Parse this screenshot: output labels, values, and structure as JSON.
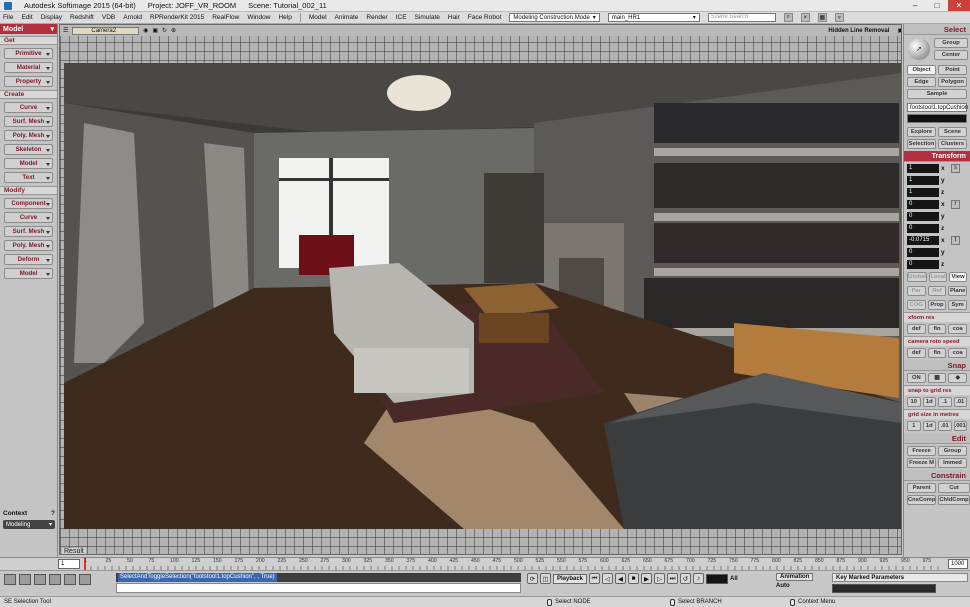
{
  "window": {
    "app_title": "Autodesk Softimage 2015 (64-bit)",
    "project": "Project: JOFF_VR_ROOM",
    "scene": "Scene: Tutorial_002_11"
  },
  "menubar": {
    "items": [
      "File",
      "Edit",
      "Display",
      "Redshift",
      "VDB",
      "Arnold",
      "RPRenderKit 2015",
      "RealFlow",
      "Window",
      "Help",
      "Model",
      "Animate",
      "Render",
      "ICE",
      "Simulate",
      "Hair",
      "Face Robot"
    ],
    "construction_mode": "Modeling Construction Mode",
    "render_pass": "main_HR1",
    "search_placeholder": "Scene Search"
  },
  "left_panel": {
    "title": "Model",
    "sections": [
      {
        "label": "Get",
        "buttons": [
          "Primitive",
          "Material",
          "Property"
        ]
      },
      {
        "label": "Create",
        "buttons": [
          "Curve",
          "Surf. Mesh",
          "Poly. Mesh",
          "Skeleton",
          "Model",
          "Text"
        ]
      },
      {
        "label": "Modify",
        "buttons": [
          "Component",
          "Curve",
          "Surf. Mesh",
          "Poly. Mesh",
          "Deform",
          "Model"
        ]
      }
    ],
    "context_label": "Context",
    "context_value": "Modeling"
  },
  "viewport": {
    "camera": "Camera2",
    "display_mode": "Hidden Line Removal",
    "result_label": "Result"
  },
  "right_panel": {
    "select_title": "Select",
    "select_buttons": [
      "Group",
      "Center",
      "Object",
      "Point",
      "Edge",
      "Polygon",
      "Sample"
    ],
    "selected_name": "footstool1.topCushion",
    "explore_buttons": [
      "Explore",
      "Scene",
      "Selection",
      "Clusters"
    ],
    "transform_title": "Transform",
    "transform_values": [
      {
        "value": "1",
        "axis": "x",
        "icon": "s"
      },
      {
        "value": "1",
        "axis": "y",
        "icon": ""
      },
      {
        "value": "1",
        "axis": "z",
        "icon": ""
      },
      {
        "value": "0",
        "axis": "x",
        "icon": "r"
      },
      {
        "value": "0",
        "axis": "y",
        "icon": ""
      },
      {
        "value": "0",
        "axis": "z",
        "icon": ""
      },
      {
        "value": "-0.0715",
        "axis": "x",
        "icon": "t"
      },
      {
        "value": "0",
        "axis": "y",
        "icon": ""
      },
      {
        "value": "0",
        "axis": "z",
        "icon": ""
      }
    ],
    "ref_row1": [
      "Global",
      "Local",
      "View"
    ],
    "ref_row2": [
      "Par",
      "Ref",
      "Plane"
    ],
    "ref_row3": [
      "COG",
      "Prop",
      "Sym"
    ],
    "xform_label": "xform res",
    "xform_buttons": [
      "def",
      "fin",
      "coa"
    ],
    "camera_label": "camera roto speed",
    "camera_buttons": [
      "def",
      "fin",
      "coa"
    ],
    "snap_title": "Snap",
    "snap_state": "ON",
    "snap_grid_label": "snap to grid res",
    "snap_grid_buttons": [
      "10",
      "1d",
      ".1",
      ".01"
    ],
    "grid_size_label": "grid size in metres",
    "grid_size_buttons": [
      "1",
      "1d",
      ".01",
      ".001"
    ],
    "edit_title": "Edit",
    "edit_buttons": [
      "Freeze",
      "Group",
      "Freeze M",
      "Immed"
    ],
    "constrain_title": "Constrain",
    "constrain_buttons": [
      "Parent",
      "Cut",
      "CnsComp",
      "ChldComp"
    ]
  },
  "timeline": {
    "start": "1",
    "end": "1000",
    "labels": [
      "1",
      "25",
      "50",
      "75",
      "100",
      "125",
      "150",
      "175",
      "200",
      "225",
      "250",
      "275",
      "300",
      "325",
      "350",
      "375",
      "400",
      "425",
      "450",
      "475",
      "500",
      "525",
      "550",
      "575",
      "600",
      "625",
      "650",
      "675",
      "700",
      "725",
      "750",
      "775",
      "800",
      "825",
      "850",
      "875",
      "900",
      "925",
      "950",
      "975"
    ],
    "end_left": "1000"
  },
  "bottom": {
    "script_command": "SelectAndToggleSelection(\"footstool1.topCushion\", , True)",
    "playback_label": "Playback",
    "frame_value": "1",
    "all_label": "All",
    "animation_label": "Animation",
    "auto_label": "Auto",
    "key_params_label": "Key Marked Parameters"
  },
  "statusbar": {
    "tool": "SE Selection Tool",
    "left_mouse": "Select NODE",
    "middle_mouse": "Select BRANCH",
    "right_mouse": "Context Menu"
  }
}
